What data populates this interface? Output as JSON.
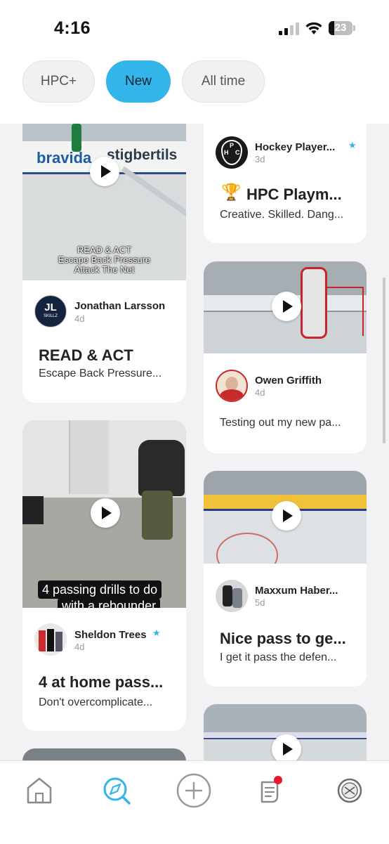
{
  "status": {
    "time": "4:16",
    "battery": "23",
    "battery_level": 0.23
  },
  "filters": [
    {
      "label": "HPC+",
      "active": false
    },
    {
      "label": "New",
      "active": true
    },
    {
      "label": "All time",
      "active": false
    }
  ],
  "feed": [
    {
      "author": "Jonathan  Larsson",
      "age": "4d",
      "title": "READ & ACT",
      "desc": "Escape Back Pressure...",
      "thumb_caption": [
        "READ & ACT",
        "Escape Back Pressure",
        "Attack The Net"
      ],
      "thumb_sign": "stigbertils",
      "thumb_sign2": "bravida",
      "avatar_text": "JL",
      "avatar_sub": "SKILLZ"
    },
    {
      "author": "Hockey Player...",
      "age": "3d",
      "title": "HPC Playm...",
      "desc": "Creative. Skilled. Dang...",
      "trophy": "🏆",
      "verified": "★",
      "avatar_text": [
        "H",
        "P",
        "C"
      ]
    },
    {
      "author": "Owen Griffith",
      "age": "4d",
      "desc": "Testing out my new pa..."
    },
    {
      "author": "Sheldon Trees",
      "age": "4d",
      "title": "4 at home pass...",
      "desc": "Don't overcomplicate...",
      "verified": "★",
      "thumb_caption": [
        "4 passing drills to do",
        "with a rebounder"
      ]
    },
    {
      "author": "Maxxum Haber...",
      "age": "5d",
      "title": "Nice pass to ge...",
      "desc": "I get it pass the defen..."
    }
  ],
  "colors": {
    "accent": "#34b5e9",
    "notification": "#e8192c"
  },
  "nav": [
    {
      "icon": "home-icon"
    },
    {
      "icon": "explore-icon",
      "active": true
    },
    {
      "icon": "add-icon"
    },
    {
      "icon": "notes-icon",
      "badge": true
    },
    {
      "icon": "hpc-logo-icon"
    }
  ]
}
